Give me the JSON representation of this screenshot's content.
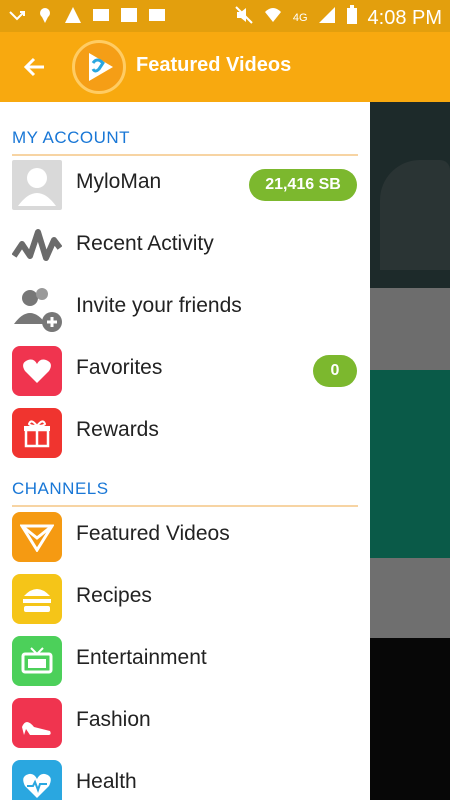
{
  "status": {
    "time": "4:08 PM",
    "network": "4G"
  },
  "appbar": {
    "title": "Featured Videos"
  },
  "account": {
    "header": "MY ACCOUNT",
    "user": {
      "name": "MyloMan",
      "balance": "21,416 SB"
    },
    "items": [
      {
        "label": "Recent Activity",
        "icon": "activity-icon"
      },
      {
        "label": "Invite your friends",
        "icon": "invite-friends-icon"
      },
      {
        "label": "Favorites",
        "icon": "heart-icon",
        "badge": "0",
        "color": "#f0344f"
      },
      {
        "label": "Rewards",
        "icon": "gift-icon",
        "color": "#f0342f"
      }
    ]
  },
  "channels": {
    "header": "CHANNELS",
    "items": [
      {
        "label": "Featured Videos",
        "icon": "featured-videos-icon",
        "color": "#f59a12"
      },
      {
        "label": "Recipes",
        "icon": "burger-icon",
        "color": "#f5c518"
      },
      {
        "label": "Entertainment",
        "icon": "tv-icon",
        "color": "#4cd05a"
      },
      {
        "label": "Fashion",
        "icon": "high-heel-icon",
        "color": "#f0344f"
      },
      {
        "label": "Health",
        "icon": "heart-pulse-icon",
        "color": "#2aa7e0"
      }
    ]
  },
  "colors": {
    "accent": "#f8a90f",
    "section": "#1977d6",
    "badge": "#7cb82e"
  }
}
